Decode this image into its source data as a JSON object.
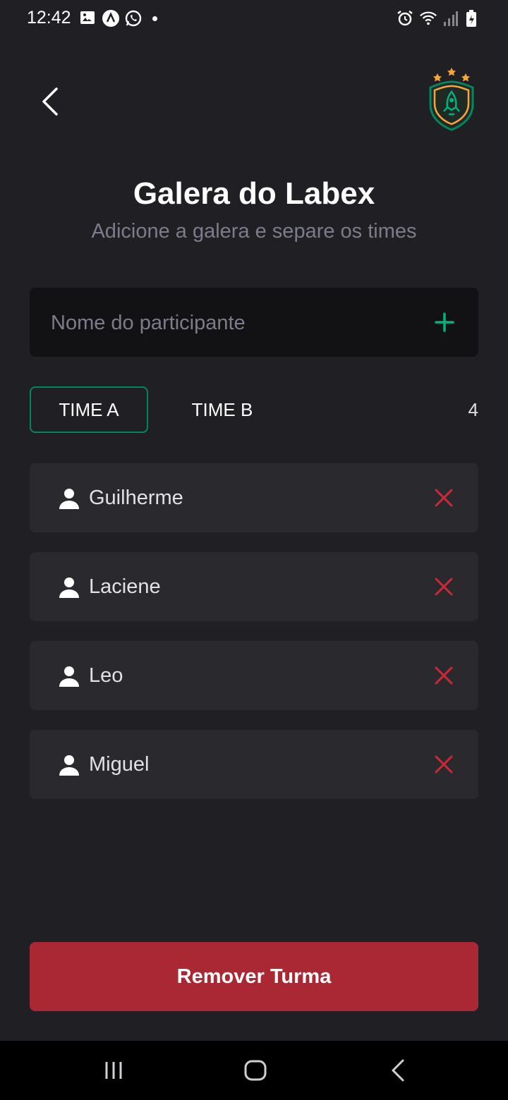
{
  "status_bar": {
    "time": "12:42",
    "left_icons": [
      "image-icon",
      "app-icon",
      "whatsapp-icon",
      "dot-icon"
    ],
    "right_icons": [
      "alarm-icon",
      "wifi-icon",
      "signal-icon",
      "battery-icon"
    ]
  },
  "header": {
    "back_icon": "chevron-left-icon",
    "logo": "team-shield-logo"
  },
  "page": {
    "title": "Galera do Labex",
    "subtitle": "Adicione a galera e separe os times"
  },
  "input": {
    "placeholder": "Nome do participante",
    "value": "",
    "add_icon": "plus-icon"
  },
  "tabs": [
    {
      "label": "TIME A",
      "active": true
    },
    {
      "label": "TIME B",
      "active": false
    }
  ],
  "player_count": "4",
  "players": [
    {
      "name": "Guilherme"
    },
    {
      "name": "Laciene"
    },
    {
      "name": "Leo"
    },
    {
      "name": "Miguel"
    }
  ],
  "remove_button": {
    "label": "Remover Turma"
  },
  "colors": {
    "background": "#202024",
    "input_bg": "#121214",
    "card_bg": "#29292e",
    "accent_green": "#00875f",
    "danger_red": "#aa2834",
    "remove_icon_red": "#cc2937",
    "muted_text": "#7c7c8a"
  },
  "nav_bar": {
    "buttons": [
      "recent-apps-icon",
      "home-icon",
      "back-icon"
    ]
  }
}
